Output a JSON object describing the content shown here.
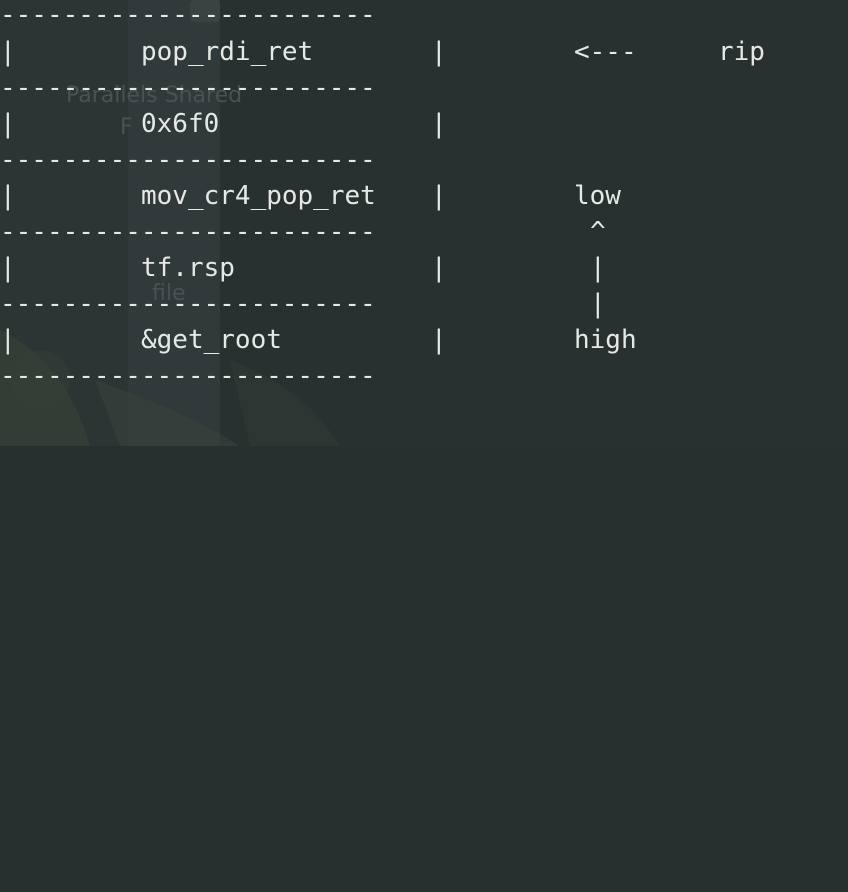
{
  "terminal": {
    "separator": "------------------------",
    "pipe": "|",
    "rows": [
      {
        "cell": "pop_rdi_ret"
      },
      {
        "cell": "0x6f0"
      },
      {
        "cell": "mov_cr4_pop_ret"
      },
      {
        "cell": "tf.rsp"
      },
      {
        "cell": "&get_root"
      }
    ],
    "annotations": {
      "arrow": "<---",
      "rip": "rip",
      "low": "low",
      "caret": "^",
      "bar": "|",
      "high": "high"
    }
  },
  "desktop": {
    "icon_label_line1": "Parallels Shared",
    "icon_label_line2": "F",
    "file_label": "file"
  },
  "colors": {
    "background": "#28302f",
    "terminal_text": "#e6e8e6",
    "ghost_text": "#4a5152"
  }
}
